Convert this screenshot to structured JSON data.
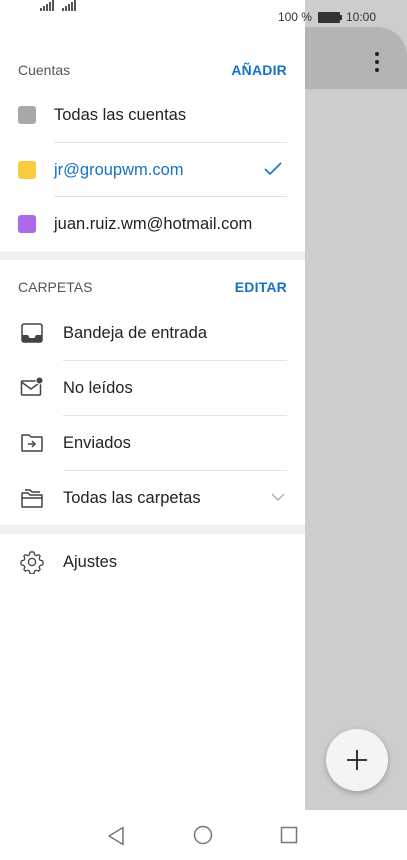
{
  "status_bar": {
    "battery_text": "100 %",
    "time": "10:00"
  },
  "accounts": {
    "title": "Cuentas",
    "action": "AÑADIR",
    "items": [
      {
        "label": "Todas las cuentas",
        "color": "#a8a8a8",
        "selected": false
      },
      {
        "label": "jr@groupwm.com",
        "color": "#f7cc3f",
        "selected": true
      },
      {
        "label": "juan.ruiz.wm@hotmail.com",
        "color": "#a86ae6",
        "selected": false
      }
    ],
    "accent_color": "#1672c6"
  },
  "folders": {
    "title": "CARPETAS",
    "action": "EDITAR",
    "items": [
      {
        "label": "Bandeja de entrada",
        "icon": "inbox-icon"
      },
      {
        "label": "No leídos",
        "icon": "unread-mail-icon"
      },
      {
        "label": "Enviados",
        "icon": "sent-folder-icon"
      },
      {
        "label": "Todas las carpetas",
        "icon": "folders-icon",
        "expandable": true
      }
    ]
  },
  "settings": {
    "label": "Ajustes",
    "icon": "gear-icon"
  },
  "fab": {
    "icon": "plus-icon"
  },
  "nav": {
    "back": "back-icon",
    "home": "home-icon",
    "recents": "recents-icon"
  }
}
